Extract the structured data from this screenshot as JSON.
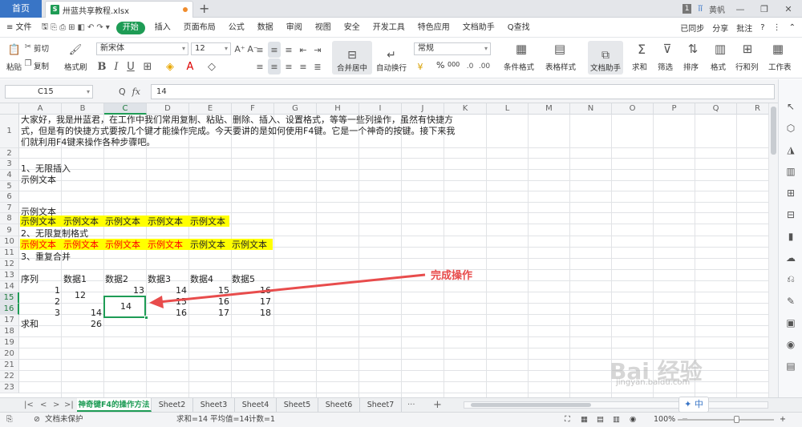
{
  "titlebar": {
    "home_tab": "首页",
    "file_name": "卅蓝共享教程.xlsx",
    "new_tab": "+",
    "page_num": "1",
    "user": "黄帆",
    "min": "—",
    "max": "❐",
    "close": "✕"
  },
  "menu": {
    "items": [
      "≡ 文件",
      "开始",
      "插入",
      "页面布局",
      "公式",
      "数据",
      "审阅",
      "视图",
      "安全",
      "开发工具",
      "特色应用",
      "文档助手"
    ],
    "active": "开始",
    "search": "Q查找",
    "sync": "已同步",
    "share": "分享",
    "comment": "批注",
    "help": "?"
  },
  "ribbon": {
    "paste": "粘贴",
    "cut": "剪切",
    "copy": "复制",
    "format_painter": "格式刷",
    "font_name": "新宋体",
    "font_size": "12",
    "merge": "合并居中",
    "wrap": "自动换行",
    "num_format": "常规",
    "cond_format": "条件格式",
    "table_style": "表格样式",
    "doc_helper": "文档助手",
    "sum": "求和",
    "filter": "筛选",
    "sort": "排序",
    "format": "格式",
    "rowcol": "行和列",
    "sheet": "工作表",
    "percent": "%",
    "thousand": "000"
  },
  "formula_bar": {
    "cell_ref": "C15",
    "value": "14",
    "q_icon": "Q",
    "fx": "fx"
  },
  "columns": [
    "A",
    "B",
    "C",
    "D",
    "E",
    "F",
    "G",
    "H",
    "I",
    "J",
    "K",
    "L",
    "M",
    "N",
    "O",
    "P",
    "Q",
    "R"
  ],
  "selected_col": "C",
  "rows": [
    "1",
    "2",
    "3",
    "4",
    "5",
    "6",
    "7",
    "8",
    "9",
    "10",
    "11",
    "12",
    "13",
    "14",
    "15",
    "16",
    "17",
    "18",
    "19",
    "20",
    "21",
    "22",
    "23"
  ],
  "selected_rows": [
    "15",
    "16"
  ],
  "cells": {
    "r1_1": "大家好，我是卅蓝君，在工作中我们常用复制、粘贴、删除、插入、设置格式，等等一些列操作，虽然有快捷方",
    "r1_2": "式，但是有的快捷方式要按几个键才能操作完成。今天要讲的是如何使用F4键。它是一个神奇的按键。接下来我",
    "r1_3": "们就利用F4键来操作各种步骤吧。",
    "r3": "1、无限插入",
    "r4": "示例文本",
    "r7": "示例文本",
    "r8": [
      "示例文本",
      "示例文本",
      "示例文本",
      "示例文本",
      "示例文本"
    ],
    "r9": "2、无限复制格式",
    "r10": [
      "示例文本",
      "示例文本",
      "示例文本",
      "示例文本",
      "示例文本",
      "示例文本"
    ],
    "r11": "3、重复合并",
    "r13": [
      "序列",
      "数据1",
      "数据2",
      "数据3",
      "数据4",
      "数据5"
    ],
    "r14": [
      "1",
      "12",
      "13",
      "14",
      "15",
      "16"
    ],
    "r15": [
      "2",
      "15",
      "16",
      "17"
    ],
    "r16": [
      "3",
      "14",
      "16",
      "17",
      "18"
    ],
    "merged_c15": "14",
    "r17": [
      "求和",
      "26"
    ]
  },
  "annotation": "完成操作",
  "sheets": {
    "tabs": [
      "神奇键F4的操作方法",
      "Sheet2",
      "Sheet3",
      "Sheet4",
      "Sheet5",
      "Sheet6",
      "Sheet7"
    ],
    "active": "神奇键F4的操作方法",
    "add": "+",
    "more": "···"
  },
  "status": {
    "protect": "文档未保护",
    "sum": "求和=14",
    "avg": "平均值=14",
    "count": "计数=1",
    "zoom": "100%",
    "ime": "中"
  },
  "watermark": {
    "main": "Bai 经验",
    "sub": "jingyan.baidu.com"
  },
  "colors": {
    "accent": "#1e9c55",
    "home_tab": "#3975c6",
    "yellow": "#ffff00",
    "red_text": "#ff0000",
    "arrow": "#e84c4c"
  }
}
